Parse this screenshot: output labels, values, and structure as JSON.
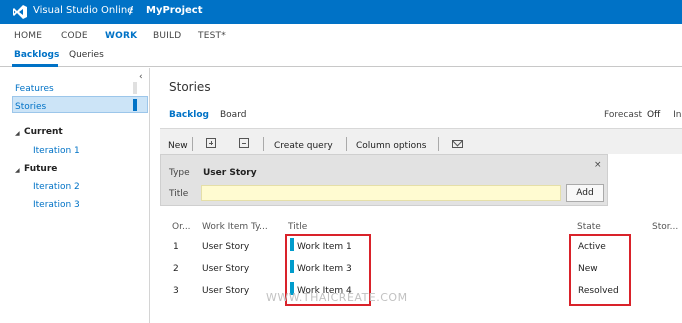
{
  "header": {
    "brand": "Visual Studio Online",
    "separator": "/",
    "project": "MyProject"
  },
  "main_nav": {
    "items": [
      "HOME",
      "CODE",
      "WORK",
      "BUILD",
      "TEST*"
    ],
    "active": "WORK"
  },
  "sub_nav": {
    "items": [
      "Backlogs",
      "Queries"
    ],
    "active": "Backlogs"
  },
  "left_panel": {
    "collapse_glyph": "‹",
    "backlog_levels": [
      "Features",
      "Stories"
    ],
    "selected_level": "Stories",
    "iterations": {
      "current_label": "Current",
      "current_items": [
        "Iteration 1"
      ],
      "future_label": "Future",
      "future_items": [
        "Iteration 2",
        "Iteration 3"
      ]
    }
  },
  "content": {
    "title": "Stories",
    "tabs": [
      "Backlog",
      "Board"
    ],
    "active_tab": "Backlog",
    "forecast_label": "Forecast",
    "forecast_value": "Off",
    "forecast_in": "In"
  },
  "toolbar": {
    "new_label": "New",
    "create_query_label": "Create query",
    "column_options_label": "Column options"
  },
  "add_panel": {
    "close_glyph": "×",
    "type_label": "Type",
    "type_value": "User Story",
    "title_label": "Title",
    "title_value": "",
    "add_button": "Add"
  },
  "grid": {
    "columns": [
      "Or...",
      "Work Item Ty...",
      "Title",
      "State",
      "Stor..."
    ],
    "rows": [
      {
        "order": "1",
        "type": "User Story",
        "title": "Work Item 1",
        "state": "Active"
      },
      {
        "order": "2",
        "type": "User Story",
        "title": "Work Item 3",
        "state": "New"
      },
      {
        "order": "3",
        "type": "User Story",
        "title": "Work Item 4",
        "state": "Resolved"
      }
    ]
  },
  "colors": {
    "header_blue": "#0072c6",
    "work_item_bar": "#009ccc",
    "highlight_red": "#d9222a",
    "title_input_bg": "#fffbd1"
  },
  "watermark": "WWW.THAICREATE.COM"
}
